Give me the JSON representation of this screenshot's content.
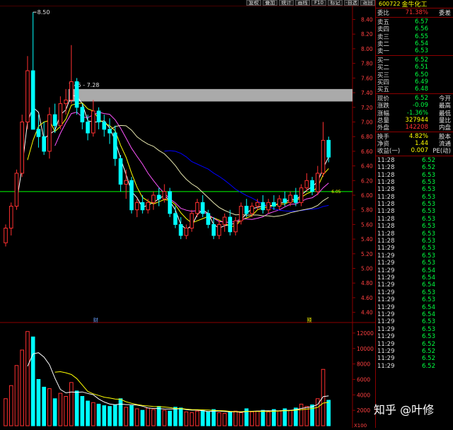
{
  "toolbar": {
    "buttons": [
      "复权",
      "叠加",
      "统计",
      "画线",
      "F10",
      "标记",
      "-自选",
      "返回"
    ]
  },
  "chart": {
    "price_axis": [
      "8.40",
      "8.20",
      "8.00",
      "7.80",
      "7.60",
      "7.40",
      "7.20",
      "7.00",
      "6.80",
      "6.60",
      "6.40",
      "6.20",
      "6.00",
      "5.80",
      "5.60",
      "5.40",
      "5.20",
      "5.00",
      "4.80",
      "4.60",
      "4.40"
    ],
    "volume_axis": [
      "12000",
      "10000",
      "8000",
      "6000",
      "4000",
      "2000"
    ],
    "volume_unit": "X100",
    "high_label": "8.50",
    "zone_label": "7.45 - 7.28",
    "support_label": "6.05",
    "event_label_1": "财",
    "event_label_2": "预",
    "colors": {
      "up": "#ff3030",
      "down": "#00ffff",
      "ma1": "#ffffff",
      "ma2": "#ffff00",
      "ma3": "#ff55ff",
      "ma4": "#0000ff",
      "ma5": "#e8e8b0",
      "support": "#00ff00"
    }
  },
  "panel": {
    "code": "600722",
    "name": "金牛化工",
    "weibi_label": "委比",
    "weibi_value": "71.38%",
    "weicha_label": "委差",
    "asks": [
      {
        "label": "卖五",
        "price": "6.57",
        "vol": ""
      },
      {
        "label": "卖四",
        "price": "6.56",
        "vol": ""
      },
      {
        "label": "卖三",
        "price": "6.55",
        "vol": ""
      },
      {
        "label": "卖二",
        "price": "6.54",
        "vol": ""
      },
      {
        "label": "卖一",
        "price": "6.53",
        "vol": ""
      }
    ],
    "bids": [
      {
        "label": "买一",
        "price": "6.52",
        "vol": ""
      },
      {
        "label": "买二",
        "price": "6.51",
        "vol": ""
      },
      {
        "label": "买三",
        "price": "6.50",
        "vol": ""
      },
      {
        "label": "买四",
        "price": "6.49",
        "vol": ""
      },
      {
        "label": "买五",
        "price": "6.48",
        "vol": ""
      }
    ],
    "quote": [
      {
        "l1": "现价",
        "v1": "6.52",
        "l2": "今开",
        "c": "g"
      },
      {
        "l1": "涨跌",
        "v1": "-0.09",
        "l2": "最高",
        "c": "g"
      },
      {
        "l1": "涨幅",
        "v1": "-1.36%",
        "l2": "最低",
        "c": "g"
      },
      {
        "l1": "总量",
        "v1": "327944",
        "l2": "量比",
        "c": "y"
      },
      {
        "l1": "外盘",
        "v1": "142208",
        "l2": "内盘",
        "c": "r"
      }
    ],
    "stats": [
      {
        "l1": "换手",
        "v1": "4.82%",
        "l2": "股本"
      },
      {
        "l1": "净资",
        "v1": "1.44",
        "l2": "流通"
      },
      {
        "l1": "收益(一)",
        "v1": "0.007",
        "l2": "PE(动)"
      }
    ],
    "ticks": [
      {
        "t": "11:28",
        "p": "6.52"
      },
      {
        "t": "11:28",
        "p": "6.52"
      },
      {
        "t": "11:28",
        "p": "6.53"
      },
      {
        "t": "11:28",
        "p": "6.53"
      },
      {
        "t": "11:28",
        "p": "6.53"
      },
      {
        "t": "11:28",
        "p": "6.53"
      },
      {
        "t": "11:28",
        "p": "6.53"
      },
      {
        "t": "11:28",
        "p": "6.53"
      },
      {
        "t": "11:28",
        "p": "6.53"
      },
      {
        "t": "11:28",
        "p": "6.53"
      },
      {
        "t": "11:28",
        "p": "6.53"
      },
      {
        "t": "11:28",
        "p": "6.53"
      },
      {
        "t": "11:29",
        "p": "6.53"
      },
      {
        "t": "11:29",
        "p": "6.53"
      },
      {
        "t": "11:29",
        "p": "6.53"
      },
      {
        "t": "11:29",
        "p": "6.54"
      },
      {
        "t": "11:29",
        "p": "6.54"
      },
      {
        "t": "11:29",
        "p": "6.54"
      },
      {
        "t": "11:29",
        "p": "6.53"
      },
      {
        "t": "11:29",
        "p": "6.53"
      },
      {
        "t": "11:29",
        "p": "6.54"
      },
      {
        "t": "11:29",
        "p": "6.54"
      },
      {
        "t": "11:29",
        "p": "6.53"
      },
      {
        "t": "11:29",
        "p": "6.53"
      },
      {
        "t": "11:29",
        "p": "6.53"
      },
      {
        "t": "11:29",
        "p": "6.52"
      },
      {
        "t": "11:29",
        "p": "6.52"
      },
      {
        "t": "11:29",
        "p": "6.52"
      },
      {
        "t": "11:29",
        "p": "6.52"
      }
    ]
  },
  "watermark": "知乎 @叶修",
  "chart_data": {
    "type": "candlestick",
    "ylim": [
      4.3,
      8.55
    ],
    "volume_ylim": [
      0,
      13000
    ],
    "support_level": 6.05,
    "zone": [
      7.28,
      7.45
    ],
    "candles": [
      [
        5.35,
        5.6,
        5.3,
        5.55
      ],
      [
        5.55,
        5.9,
        5.45,
        5.85
      ],
      [
        5.85,
        6.35,
        5.8,
        6.3
      ],
      [
        6.3,
        7.1,
        6.25,
        7.0
      ],
      [
        7.0,
        7.9,
        6.9,
        7.7
      ],
      [
        7.7,
        8.5,
        7.6,
        6.9
      ],
      [
        6.9,
        7.1,
        6.65,
        6.8
      ],
      [
        6.8,
        7.0,
        6.55,
        6.6
      ],
      [
        6.6,
        7.2,
        6.5,
        7.1
      ],
      [
        7.1,
        7.25,
        6.85,
        6.95
      ],
      [
        6.95,
        7.35,
        6.9,
        7.25
      ],
      [
        7.25,
        7.45,
        7.1,
        7.3
      ],
      [
        7.3,
        8.05,
        7.25,
        7.55
      ],
      [
        7.55,
        7.6,
        7.1,
        7.2
      ],
      [
        7.2,
        7.25,
        6.9,
        7.0
      ],
      [
        7.0,
        7.1,
        6.75,
        6.85
      ],
      [
        6.85,
        7.3,
        6.8,
        7.15
      ],
      [
        7.15,
        7.2,
        6.9,
        7.0
      ],
      [
        7.0,
        7.1,
        6.8,
        6.9
      ],
      [
        6.9,
        7.05,
        6.7,
        6.85
      ],
      [
        6.85,
        6.95,
        6.4,
        6.5
      ],
      [
        6.5,
        6.55,
        6.05,
        6.15
      ],
      [
        6.15,
        6.35,
        5.95,
        6.2
      ],
      [
        6.2,
        6.25,
        5.75,
        5.8
      ],
      [
        5.8,
        5.95,
        5.7,
        5.9
      ],
      [
        5.9,
        6.0,
        5.75,
        5.8
      ],
      [
        5.8,
        5.95,
        5.75,
        5.9
      ],
      [
        5.9,
        6.05,
        5.8,
        6.0
      ],
      [
        6.0,
        6.1,
        5.85,
        5.95
      ],
      [
        5.95,
        6.15,
        5.9,
        6.05
      ],
      [
        6.05,
        6.1,
        5.7,
        5.75
      ],
      [
        5.75,
        5.85,
        5.55,
        5.6
      ],
      [
        5.6,
        5.7,
        5.4,
        5.45
      ],
      [
        5.45,
        5.6,
        5.4,
        5.55
      ],
      [
        5.55,
        5.8,
        5.5,
        5.75
      ],
      [
        5.75,
        5.95,
        5.7,
        5.9
      ],
      [
        5.9,
        6.0,
        5.7,
        5.75
      ],
      [
        5.75,
        5.8,
        5.55,
        5.6
      ],
      [
        5.6,
        5.7,
        5.4,
        5.45
      ],
      [
        5.45,
        5.65,
        5.4,
        5.6
      ],
      [
        5.6,
        5.75,
        5.5,
        5.7
      ],
      [
        5.7,
        5.8,
        5.45,
        5.5
      ],
      [
        5.5,
        5.7,
        5.45,
        5.65
      ],
      [
        5.65,
        5.9,
        5.6,
        5.85
      ],
      [
        5.85,
        5.95,
        5.7,
        5.75
      ],
      [
        5.75,
        5.9,
        5.7,
        5.85
      ],
      [
        5.85,
        5.95,
        5.8,
        5.9
      ],
      [
        5.9,
        6.0,
        5.75,
        5.8
      ],
      [
        5.8,
        5.95,
        5.75,
        5.9
      ],
      [
        5.9,
        6.0,
        5.8,
        5.85
      ],
      [
        5.85,
        6.0,
        5.8,
        5.95
      ],
      [
        5.95,
        6.05,
        5.85,
        5.9
      ],
      [
        5.9,
        6.05,
        5.85,
        6.0
      ],
      [
        6.0,
        6.1,
        5.85,
        5.9
      ],
      [
        5.9,
        6.15,
        5.85,
        6.1
      ],
      [
        6.1,
        6.3,
        6.05,
        6.2
      ],
      [
        6.2,
        6.25,
        6.0,
        6.05
      ],
      [
        6.05,
        6.4,
        6.0,
        6.3
      ],
      [
        6.3,
        7.0,
        6.25,
        6.75
      ],
      [
        6.75,
        6.8,
        6.45,
        6.52
      ]
    ],
    "volumes": [
      3500,
      5200,
      7800,
      9800,
      12200,
      11500,
      6000,
      5000,
      4800,
      3500,
      4200,
      3800,
      5600,
      4500,
      3800,
      3200,
      3000,
      2800,
      2600,
      2500,
      2700,
      3500,
      2400,
      2600,
      2200,
      2000,
      2300,
      2100,
      2500,
      2000,
      1900,
      2400,
      2300,
      1800,
      1700,
      1900,
      2000,
      1800,
      2100,
      1700,
      1600,
      1800,
      1900,
      1700,
      2200,
      1800,
      1900,
      2000,
      1800,
      2100,
      1900,
      2200,
      2000,
      2300,
      2800,
      2500,
      2700,
      3500,
      7300,
      3300
    ]
  }
}
